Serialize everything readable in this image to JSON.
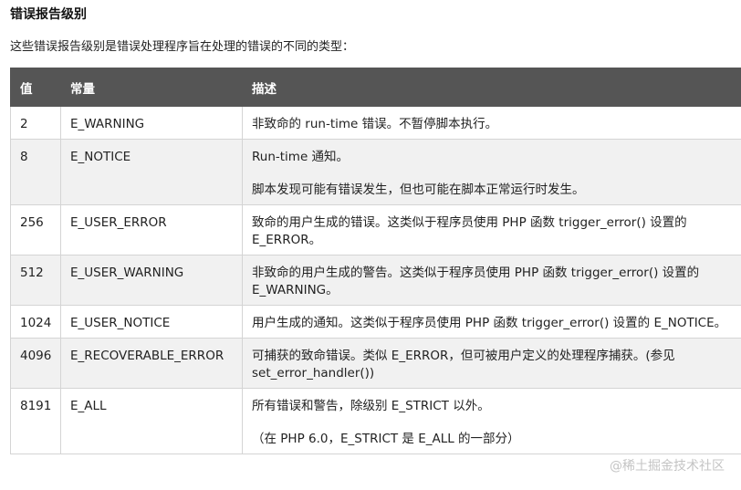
{
  "heading": "错误报告级别",
  "intro": "这些错误报告级别是错误处理程序旨在处理的错误的不同的类型：",
  "table": {
    "headers": [
      "值",
      "常量",
      "描述"
    ],
    "rows": [
      {
        "value": "2",
        "constant": "E_WARNING",
        "desc": [
          "非致命的 run-time 错误。不暂停脚本执行。"
        ]
      },
      {
        "value": "8",
        "constant": "E_NOTICE",
        "desc": [
          "Run-time 通知。",
          "脚本发现可能有错误发生，但也可能在脚本正常运行时发生。"
        ]
      },
      {
        "value": "256",
        "constant": "E_USER_ERROR",
        "desc": [
          "致命的用户生成的错误。这类似于程序员使用 PHP 函数 trigger_error() 设置的 E_ERROR。"
        ]
      },
      {
        "value": "512",
        "constant": "E_USER_WARNING",
        "desc": [
          "非致命的用户生成的警告。这类似于程序员使用 PHP 函数 trigger_error() 设置的 E_WARNING。"
        ]
      },
      {
        "value": "1024",
        "constant": "E_USER_NOTICE",
        "desc": [
          "用户生成的通知。这类似于程序员使用 PHP 函数 trigger_error() 设置的 E_NOTICE。"
        ]
      },
      {
        "value": "4096",
        "constant": "E_RECOVERABLE_ERROR",
        "desc": [
          "可捕获的致命错误。类似 E_ERROR，但可被用户定义的处理程序捕获。(参见 set_error_handler())"
        ]
      },
      {
        "value": "8191",
        "constant": "E_ALL",
        "desc": [
          "所有错误和警告，除级别 E_STRICT 以外。",
          "（在 PHP 6.0，E_STRICT 是 E_ALL 的一部分）"
        ]
      }
    ]
  },
  "watermark": "@稀土掘金技术社区"
}
